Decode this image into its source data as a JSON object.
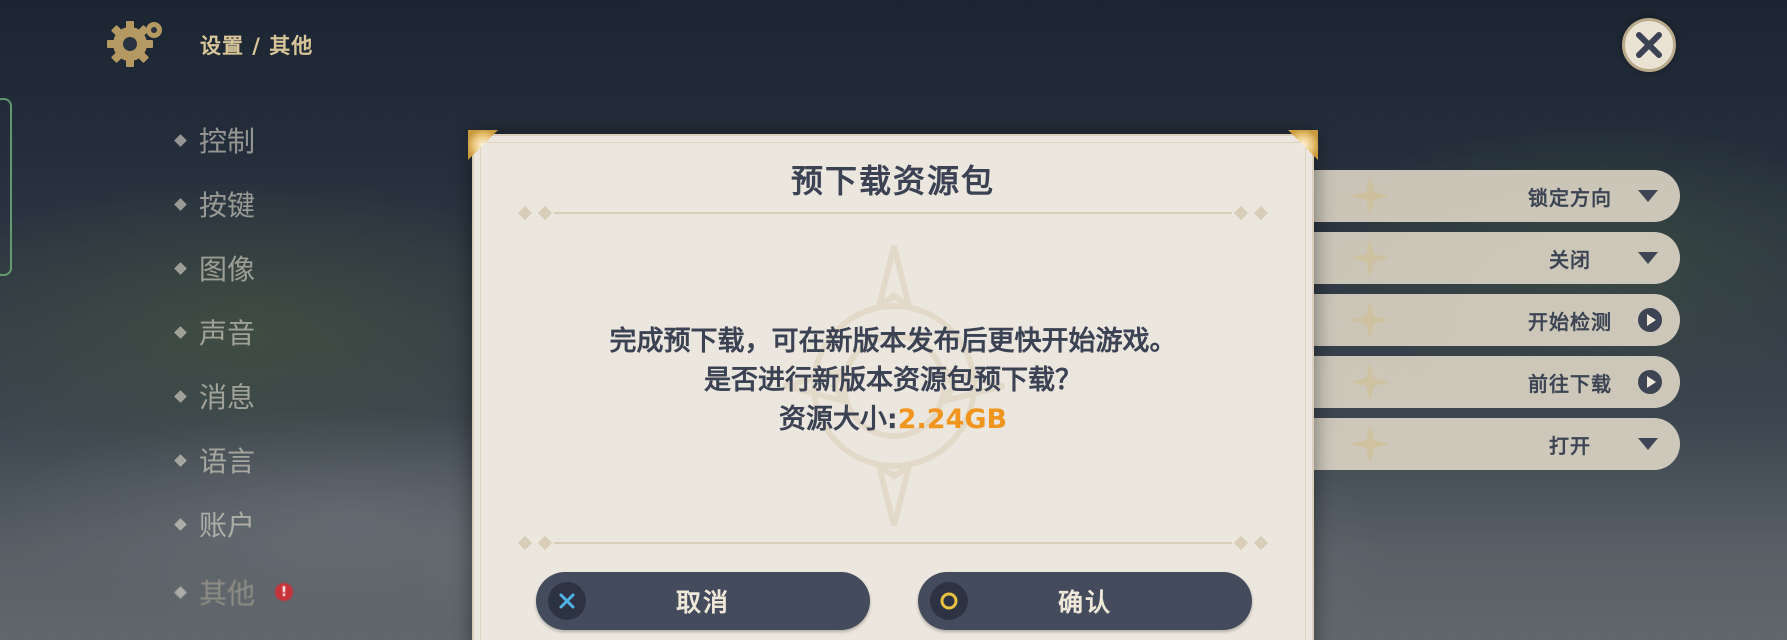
{
  "header": {
    "breadcrumb": "设置 / 其他",
    "close_label": "✕"
  },
  "sidebar": {
    "items": [
      {
        "label": "控制"
      },
      {
        "label": "按键"
      },
      {
        "label": "图像"
      },
      {
        "label": "声音"
      },
      {
        "label": "消息"
      },
      {
        "label": "语言"
      },
      {
        "label": "账户"
      },
      {
        "label": "其他",
        "badge": "!"
      }
    ]
  },
  "options": [
    {
      "value": "锁定方向",
      "control": "dropdown"
    },
    {
      "value": "关闭",
      "control": "dropdown"
    },
    {
      "value": "开始检测",
      "control": "action"
    },
    {
      "value": "前往下载",
      "control": "action"
    },
    {
      "value": "打开",
      "control": "dropdown"
    }
  ],
  "dialog": {
    "title": "预下载资源包",
    "line1": "完成预下载，可在新版本发布后更快开始游戏。",
    "line2": "是否进行新版本资源包预下载？",
    "size_label": "资源大小:",
    "size_value": "2.24GB",
    "cancel_label": "取消",
    "confirm_label": "确认"
  },
  "colors": {
    "accent_orange": "#f0961e",
    "button_dark": "#444b5d",
    "dialog_bg": "#ece7de",
    "text_dark": "#3b4254",
    "gold": "#d8c69a",
    "badge_red": "#c8333a"
  }
}
